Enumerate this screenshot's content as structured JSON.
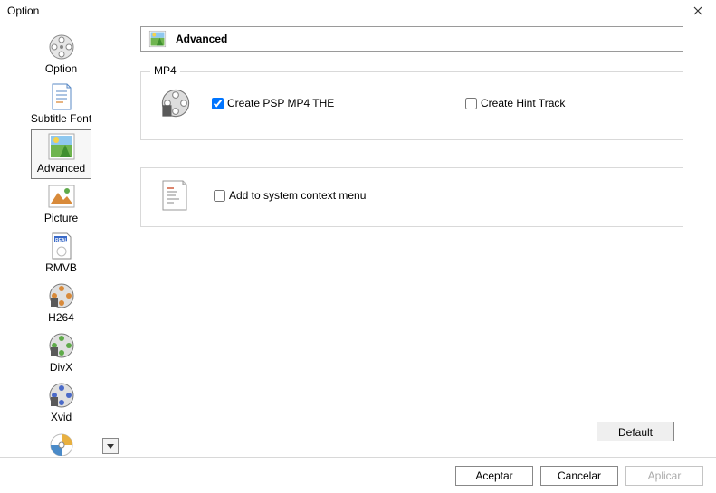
{
  "window": {
    "title": "Option"
  },
  "sidebar": {
    "items": [
      {
        "label": "Option"
      },
      {
        "label": "Subtitle Font"
      },
      {
        "label": "Advanced"
      },
      {
        "label": "Picture"
      },
      {
        "label": "RMVB"
      },
      {
        "label": "H264"
      },
      {
        "label": "DivX"
      },
      {
        "label": "Xvid"
      }
    ]
  },
  "header": {
    "title": "Advanced"
  },
  "mp4_group": {
    "legend": "MP4",
    "create_psp": {
      "label": "Create PSP MP4 THE",
      "checked": true
    },
    "create_hint": {
      "label": "Create Hint Track",
      "checked": false
    }
  },
  "context_group": {
    "add_context": {
      "label": "Add to system context menu",
      "checked": false
    }
  },
  "buttons": {
    "default": "Default",
    "accept": "Aceptar",
    "cancel": "Cancelar",
    "apply": "Aplicar"
  }
}
